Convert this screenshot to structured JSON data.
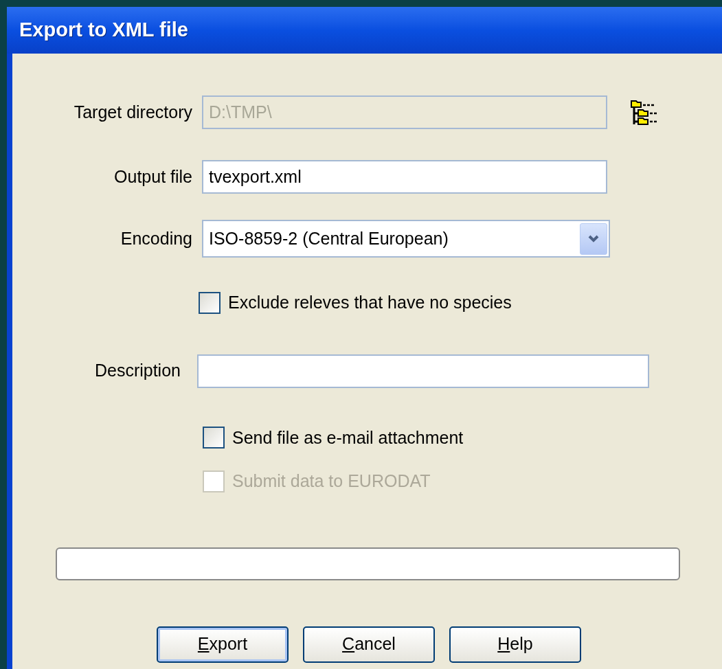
{
  "window": {
    "title": "Export to XML file"
  },
  "target_directory": {
    "label": "Target directory",
    "value": "D:\\TMP\\",
    "disabled": true
  },
  "output_file": {
    "label": "Output file",
    "value": "tvexport.xml"
  },
  "encoding": {
    "label": "Encoding",
    "value": "ISO-8859-2 (Central European)"
  },
  "checkboxes_1": [
    {
      "label": "Exclude releves that have no species",
      "checked": false,
      "disabled": false
    }
  ],
  "description": {
    "label": "Description"
  },
  "checkboxes_2": [
    {
      "label": "Send file as e-mail attachment",
      "checked": false,
      "disabled": false
    },
    {
      "label": "Submit data to EURODAT",
      "checked": false,
      "disabled": true
    }
  ],
  "buttons": [
    {
      "label": "Export",
      "default": true,
      "access_key_shown": true
    },
    {
      "label": "Cancel",
      "default": false,
      "access_key_shown": true
    },
    {
      "label": "Help",
      "default": false,
      "access_key_shown": true
    }
  ]
}
